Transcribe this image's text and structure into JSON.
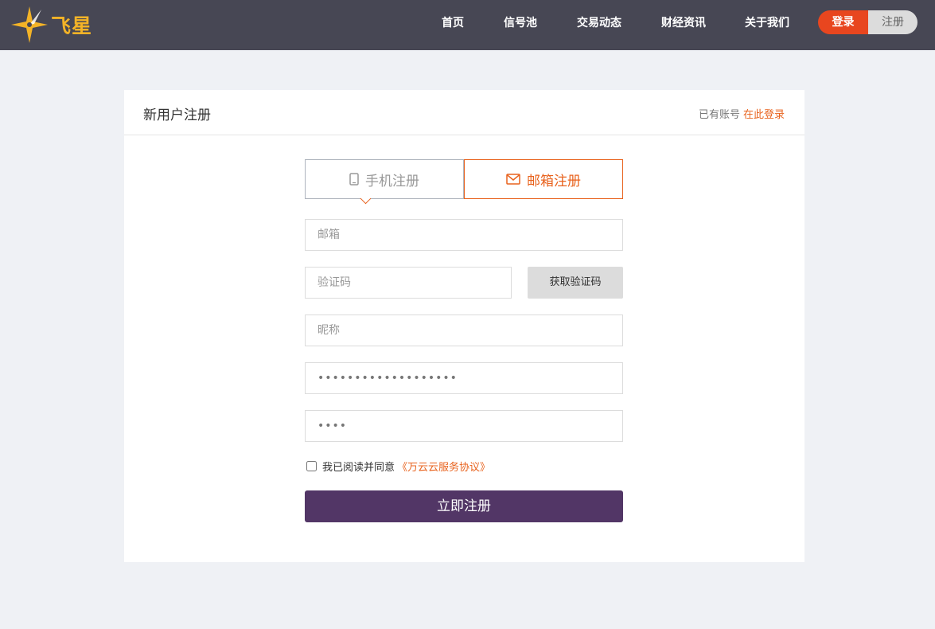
{
  "brand": {
    "name": "飞星",
    "logo_icon": "star-compass-icon",
    "color": "#f3b327"
  },
  "nav": {
    "items": [
      "首页",
      "信号池",
      "交易动态",
      "财经资讯",
      "关于我们"
    ],
    "login_label": "登录",
    "register_label": "注册"
  },
  "card": {
    "title": "新用户注册",
    "has_account_text": "已有账号",
    "login_link": "在此登录"
  },
  "tabs": {
    "phone": {
      "label": "手机注册",
      "icon": "phone-icon"
    },
    "email": {
      "label": "邮箱注册",
      "icon": "mail-icon",
      "active": true
    }
  },
  "form": {
    "email_placeholder": "邮箱",
    "code_placeholder": "验证码",
    "get_code_label": "获取验证码",
    "nickname_placeholder": "昵称",
    "password_value": "•••••••••••••••••••",
    "confirm_value": "••••",
    "agree_text": "我已阅读并同意",
    "agree_link": "《万云云服务协议》",
    "submit_label": "立即注册"
  },
  "colors": {
    "header_bg": "#474754",
    "accent_orange": "#e8621d",
    "login_red": "#e8461f",
    "submit_purple": "#523666",
    "page_bg": "#eff1f5"
  }
}
